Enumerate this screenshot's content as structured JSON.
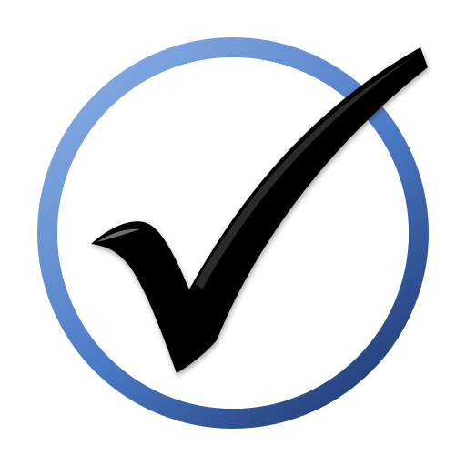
{
  "icon": {
    "name": "checkmark-in-circle",
    "ring_color_light": "#7fa6df",
    "ring_color_mid": "#4a78c4",
    "ring_color_dark": "#233f7a",
    "check_color": "#000000",
    "check_highlight": "#5a5a5a",
    "background_color": "#ffffff"
  }
}
